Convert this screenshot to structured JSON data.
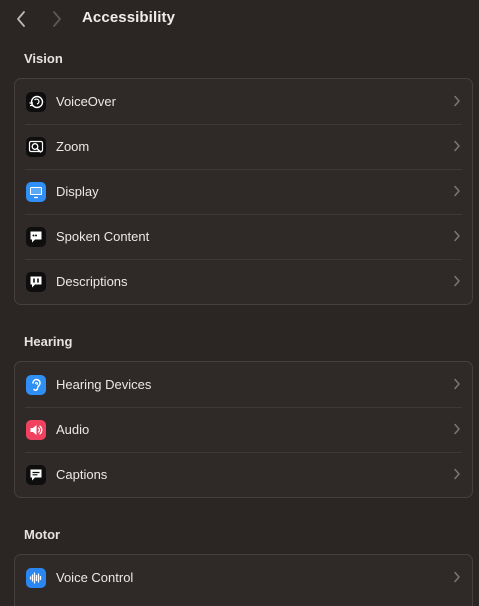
{
  "header": {
    "title": "Accessibility",
    "back_icon": "chevron-left-icon",
    "forward_icon": "chevron-right-icon"
  },
  "sections": [
    {
      "title": "Vision",
      "items": [
        {
          "label": "VoiceOver",
          "icon": "voiceover-icon"
        },
        {
          "label": "Zoom",
          "icon": "zoom-icon"
        },
        {
          "label": "Display",
          "icon": "display-icon"
        },
        {
          "label": "Spoken Content",
          "icon": "spoken-content-icon"
        },
        {
          "label": "Descriptions",
          "icon": "descriptions-icon"
        }
      ]
    },
    {
      "title": "Hearing",
      "items": [
        {
          "label": "Hearing Devices",
          "icon": "ear-icon"
        },
        {
          "label": "Audio",
          "icon": "speaker-icon"
        },
        {
          "label": "Captions",
          "icon": "captions-icon"
        }
      ]
    },
    {
      "title": "Motor",
      "items": [
        {
          "label": "Voice Control",
          "icon": "voice-control-icon"
        }
      ]
    }
  ],
  "colors": {
    "background": "#2b2624",
    "group_background": "#2f2a28",
    "display_icon": "#2f8ff5",
    "ear_icon": "#2f8ff5",
    "speaker_icon": "#f0425f",
    "voice_control_icon": "#2a86f0",
    "dark_icon": "#0e0e0e"
  }
}
